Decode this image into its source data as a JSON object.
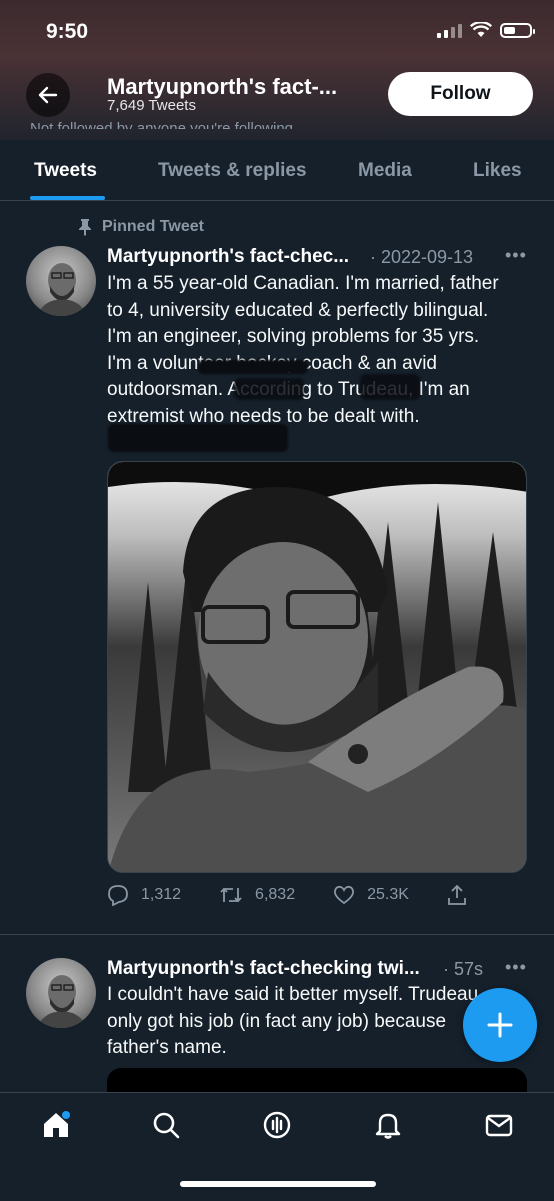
{
  "status_bar": {
    "time": "9:50"
  },
  "header": {
    "name": "Martyupnorth's fact-...",
    "tweet_count": "7,649 Tweets",
    "follow_label": "Follow",
    "followers_note": "Not followed by anyone you're following"
  },
  "tabs": [
    {
      "label": "Tweets",
      "active": true
    },
    {
      "label": "Tweets & replies"
    },
    {
      "label": "Media"
    },
    {
      "label": "Likes"
    }
  ],
  "tweets": [
    {
      "pinned_label": "Pinned Tweet",
      "name": "Martyupnorth's fact-chec...",
      "date": "· 2022-09-13",
      "text_lines": [
        "I'm a 55 year-old Canadian. I'm married, father",
        "to 4, university educated & perfectly bilingual.",
        "I'm an engineer, solving problems for 35 yrs.",
        "I'm a volunteer hockey coach & an avid",
        "outdoorsman. According to Trudeau, I'm an",
        "extremist who needs to be dealt with."
      ],
      "replies": "1,312",
      "retweets": "6,832",
      "likes": "25.3K"
    },
    {
      "name": "Martyupnorth's fact-checking twi...",
      "date": "· 57s",
      "text_lines": [
        "I couldn't have said it better myself.  Trudeau",
        "only got his job (in fact any job) because",
        "father's name."
      ]
    }
  ],
  "colors": {
    "background": "#15202b",
    "accent": "#1d9bf0",
    "secondary_text": "#8b98a5",
    "divider": "#38444d"
  },
  "icons": {
    "back": "arrow-left-icon",
    "pin": "pin-icon",
    "more": "more-dots-icon",
    "reply": "reply-icon",
    "retweet": "retweet-icon",
    "like": "heart-icon",
    "share": "share-icon",
    "compose": "plus-icon",
    "nav": [
      "home-icon",
      "search-icon",
      "spaces-icon",
      "notifications-icon",
      "messages-icon"
    ]
  }
}
